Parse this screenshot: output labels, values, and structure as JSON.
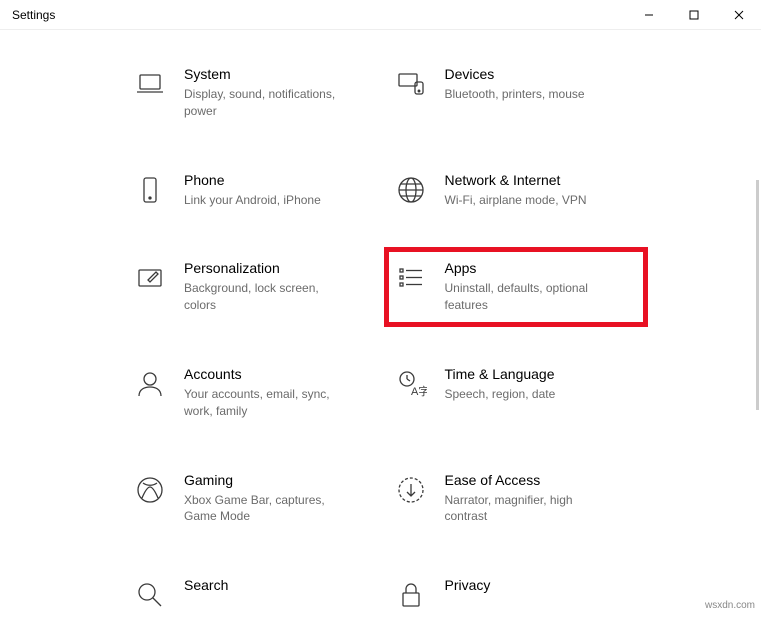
{
  "window": {
    "title": "Settings"
  },
  "categories": [
    {
      "id": "system",
      "title": "System",
      "desc": "Display, sound, notifications, power"
    },
    {
      "id": "devices",
      "title": "Devices",
      "desc": "Bluetooth, printers, mouse"
    },
    {
      "id": "phone",
      "title": "Phone",
      "desc": "Link your Android, iPhone"
    },
    {
      "id": "network",
      "title": "Network & Internet",
      "desc": "Wi-Fi, airplane mode, VPN"
    },
    {
      "id": "personalization",
      "title": "Personalization",
      "desc": "Background, lock screen, colors"
    },
    {
      "id": "apps",
      "title": "Apps",
      "desc": "Uninstall, defaults, optional features",
      "highlighted": true
    },
    {
      "id": "accounts",
      "title": "Accounts",
      "desc": "Your accounts, email, sync, work, family"
    },
    {
      "id": "time",
      "title": "Time & Language",
      "desc": "Speech, region, date"
    },
    {
      "id": "gaming",
      "title": "Gaming",
      "desc": "Xbox Game Bar, captures, Game Mode"
    },
    {
      "id": "ease",
      "title": "Ease of Access",
      "desc": "Narrator, magnifier, high contrast"
    },
    {
      "id": "search",
      "title": "Search",
      "desc": ""
    },
    {
      "id": "privacy",
      "title": "Privacy",
      "desc": ""
    }
  ],
  "watermark": "wsxdn.com"
}
